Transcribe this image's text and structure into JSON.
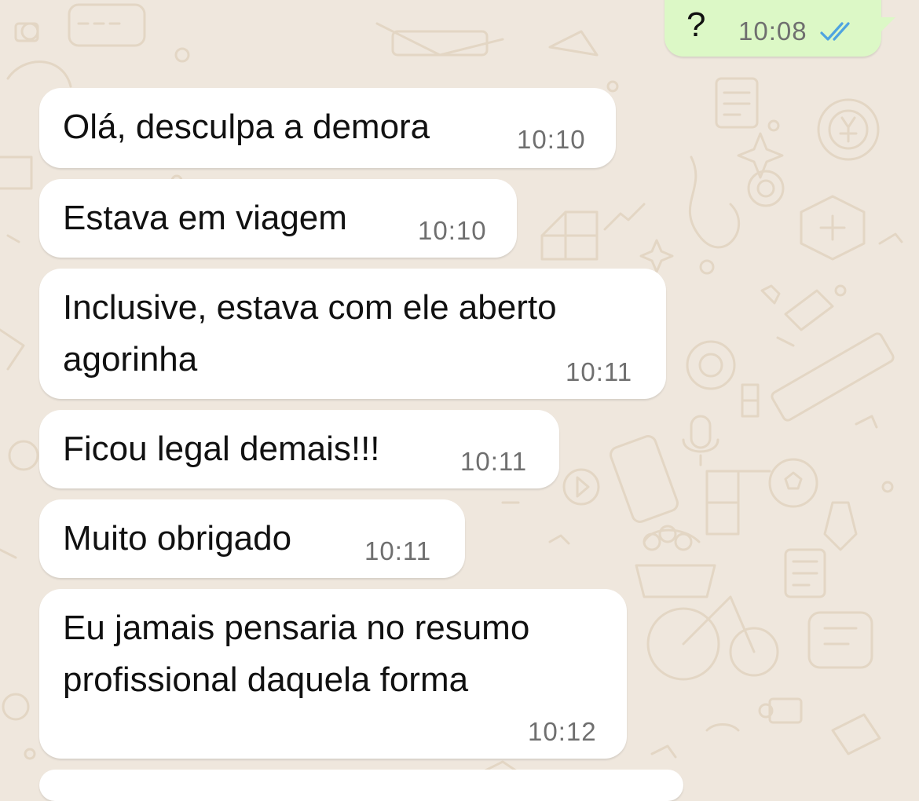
{
  "chat": {
    "outgoing": {
      "text": "?",
      "time": "10:08",
      "status_icon": "double-check-read-icon",
      "status_color": "#4fa3e0"
    },
    "messages": [
      {
        "text": "Olá, desculpa a demora",
        "time": "10:10"
      },
      {
        "text": "Estava em viagem",
        "time": "10:10"
      },
      {
        "line1": "Inclusive, estava com ele aberto",
        "line2": "agorinha",
        "time": "10:11"
      },
      {
        "text": "Ficou legal demais!!!",
        "time": "10:11"
      },
      {
        "text": "Muito obrigado",
        "time": "10:11"
      },
      {
        "line1": "Eu jamais pensaria no resumo",
        "line2": "profissional daquela forma",
        "time": "10:12"
      }
    ]
  },
  "theme": {
    "chat_background": "#efe7dd",
    "incoming_bubble": "#ffffff",
    "outgoing_bubble": "#dcf8c6"
  }
}
